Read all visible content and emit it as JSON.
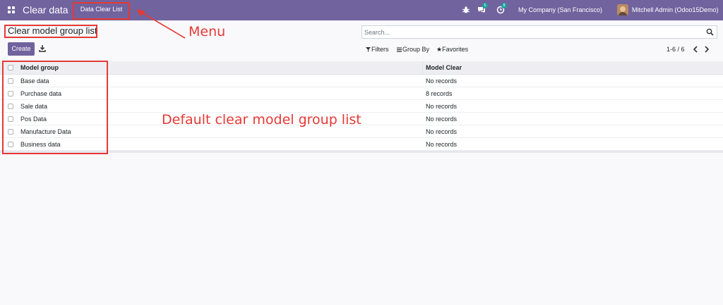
{
  "topbar": {
    "app_title": "Clear data",
    "menu_item": "Data Clear List",
    "messages_count": "5",
    "activities_count": "8",
    "company": "My Company (San Francisco)",
    "user": "Mitchell Admin (Odoo15Demo)"
  },
  "breadcrumb": "Clear model group list",
  "search": {
    "placeholder": "Search..."
  },
  "buttons": {
    "create": "Create"
  },
  "filters": {
    "filters": "Filters",
    "group_by": "Group By",
    "favorites": "Favorites"
  },
  "pager": "1-6 / 6",
  "table": {
    "headers": [
      "Model group",
      "Model Clear"
    ],
    "rows": [
      {
        "group": "Base data",
        "clear": "No records"
      },
      {
        "group": "Purchase data",
        "clear": "8 records"
      },
      {
        "group": "Sale data",
        "clear": "No records"
      },
      {
        "group": "Pos Data",
        "clear": "No records"
      },
      {
        "group": "Manufacture Data",
        "clear": "No records"
      },
      {
        "group": "Business data",
        "clear": "No records"
      }
    ]
  },
  "annotations": {
    "menu_label": "Menu",
    "list_label": "Default clear model group list"
  },
  "colors": {
    "brand": "#71639e",
    "annotation": "#e53935"
  }
}
